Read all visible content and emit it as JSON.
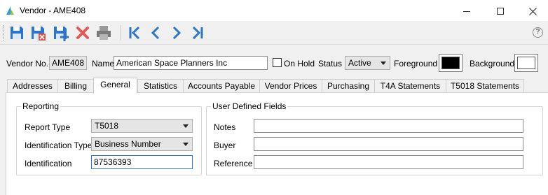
{
  "window": {
    "title": "Vendor - AME408",
    "minimize_icon": "minimize-icon",
    "maximize_icon": "maximize-icon",
    "close_icon": "close-icon"
  },
  "toolbar": {
    "buttons": [
      "save-icon",
      "save-close-icon",
      "save-new-icon",
      "delete-icon",
      "print-icon",
      "first-record-icon",
      "previous-record-icon",
      "next-record-icon",
      "last-record-icon"
    ],
    "help_label": "?",
    "colors": {
      "blue": "#2e75c6",
      "red": "#d9534f",
      "gray": "#7a7a7a"
    }
  },
  "header": {
    "vendor_no_label": "Vendor No.",
    "vendor_no_value": "AME408",
    "name_label": "Name",
    "name_value": "American Space Planners Inc",
    "on_hold_label": "On Hold",
    "status_label": "Status",
    "status_value": "Active",
    "foreground_label": "Foreground",
    "foreground_color": "#000000",
    "background_label": "Background",
    "background_color": "#ffffff"
  },
  "tabs": [
    {
      "label": "Addresses"
    },
    {
      "label": "Billing"
    },
    {
      "label": "General",
      "active": true
    },
    {
      "label": "Statistics"
    },
    {
      "label": "Accounts Payable"
    },
    {
      "label": "Vendor Prices"
    },
    {
      "label": "Purchasing"
    },
    {
      "label": "T4A Statements"
    },
    {
      "label": "T5018 Statements"
    }
  ],
  "reporting": {
    "title": "Reporting",
    "report_type_label": "Report Type",
    "report_type_value": "T5018",
    "identification_type_label": "Identification Type",
    "identification_type_value": "Business Number",
    "identification_label": "Identification",
    "identification_value": "87536393"
  },
  "user_defined": {
    "title": "User Defined Fields",
    "notes_label": "Notes",
    "notes_value": "",
    "buyer_label": "Buyer",
    "buyer_value": "",
    "reference_label": "Reference",
    "reference_value": ""
  }
}
